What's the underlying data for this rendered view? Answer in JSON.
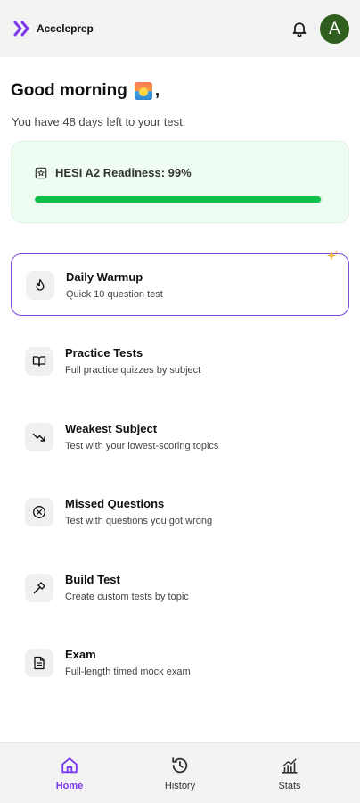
{
  "header": {
    "app_name": "Acceleprep",
    "avatar_initial": "A",
    "brand_color": "#7c3aed",
    "avatar_color": "#2f5e1f"
  },
  "greeting": {
    "text": "Good morning",
    "emoji_icon": "sunrise-icon",
    "punctuation": ","
  },
  "days_left_text": "You have 48 days left to your test.",
  "readiness": {
    "label": "HESI A2 Readiness: 99%",
    "percent": 99,
    "icon": "badge-star-icon",
    "bar_color": "#0ec048"
  },
  "menu": {
    "items": [
      {
        "title": "Daily Warmup",
        "subtitle": "Quick 10 question test",
        "icon": "flame-icon",
        "active": true
      },
      {
        "title": "Practice Tests",
        "subtitle": "Full practice quizzes by subject",
        "icon": "book-open-icon",
        "active": false
      },
      {
        "title": "Weakest Subject",
        "subtitle": "Test with your lowest-scoring topics",
        "icon": "trending-down-icon",
        "active": false
      },
      {
        "title": "Missed Questions",
        "subtitle": "Test with questions you got wrong",
        "icon": "x-circle-icon",
        "active": false
      },
      {
        "title": "Build Test",
        "subtitle": "Create custom tests by topic",
        "icon": "hammer-icon",
        "active": false
      },
      {
        "title": "Exam",
        "subtitle": "Full-length timed mock exam",
        "icon": "document-icon",
        "active": false
      }
    ]
  },
  "bottom_nav": {
    "items": [
      {
        "label": "Home",
        "icon": "home-icon",
        "active": true
      },
      {
        "label": "History",
        "icon": "history-icon",
        "active": false
      },
      {
        "label": "Stats",
        "icon": "stats-icon",
        "active": false
      }
    ]
  }
}
